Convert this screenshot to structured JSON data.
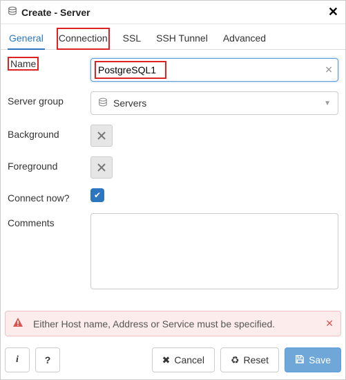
{
  "dialog": {
    "title": "Create - Server"
  },
  "tabs": {
    "general": "General",
    "connection": "Connection",
    "ssl": "SSL",
    "ssh": "SSH Tunnel",
    "advanced": "Advanced",
    "active": "general",
    "highlighted": "connection"
  },
  "fields": {
    "name": {
      "label": "Name",
      "value": "PostgreSQL1"
    },
    "server_group": {
      "label": "Server group",
      "value": "Servers"
    },
    "background": {
      "label": "Background"
    },
    "foreground": {
      "label": "Foreground"
    },
    "connect_now": {
      "label": "Connect now?",
      "checked": true
    },
    "comments": {
      "label": "Comments",
      "value": ""
    }
  },
  "alert": {
    "text": "Either Host name, Address or Service must be specified."
  },
  "buttons": {
    "info": "i",
    "help": "?",
    "cancel": "Cancel",
    "reset": "Reset",
    "save": "Save"
  }
}
